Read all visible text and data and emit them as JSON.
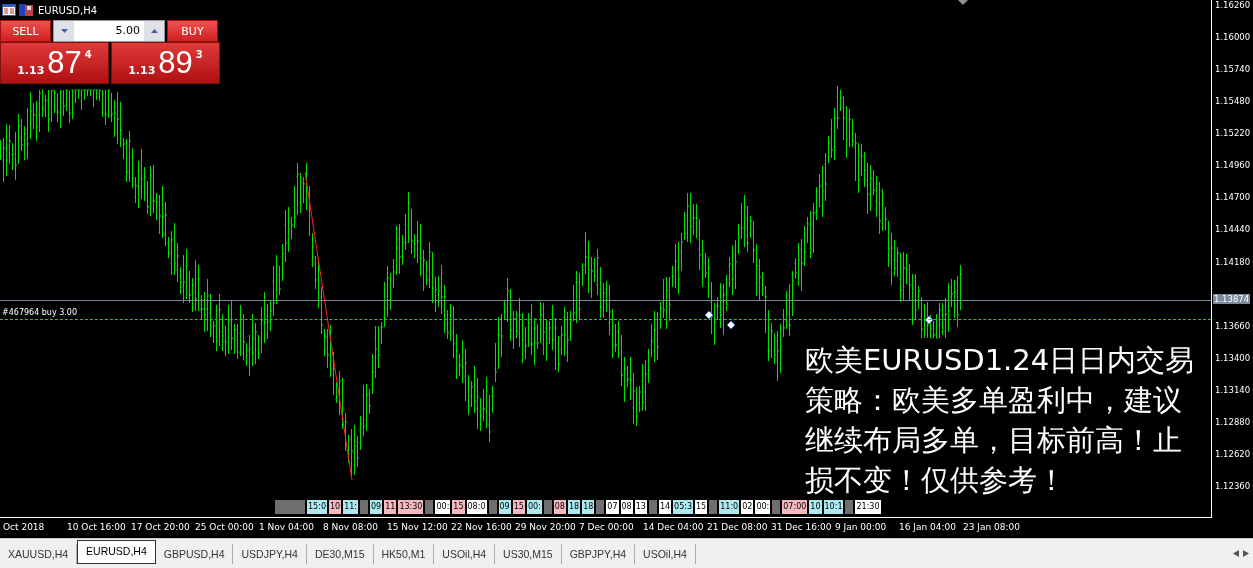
{
  "chart_window": {
    "title": "EURUSD,H4"
  },
  "trade_panel": {
    "sell_label": "SELL",
    "buy_label": "BUY",
    "lots": "5.00",
    "bid": {
      "prefix": "1.13",
      "big": "87",
      "small": "4"
    },
    "ask": {
      "prefix": "1.13",
      "big": "89",
      "small": "3"
    }
  },
  "order_line": {
    "label": "#467964 buy 3.00"
  },
  "price_axis": [
    {
      "label": "1.16260",
      "kind": "tick"
    },
    {
      "label": "1.16000",
      "kind": "tick"
    },
    {
      "label": "1.15740",
      "kind": "tick"
    },
    {
      "label": "1.15480",
      "kind": "tick"
    },
    {
      "label": "1.15220",
      "kind": "tick"
    },
    {
      "label": "1.14960",
      "kind": "tick"
    },
    {
      "label": "1.14700",
      "kind": "tick"
    },
    {
      "label": "1.14440",
      "kind": "tick"
    },
    {
      "label": "1.14180",
      "kind": "tick"
    },
    {
      "label": "1.13874",
      "kind": "current"
    },
    {
      "label": "1.13660",
      "kind": "tick"
    },
    {
      "label": "1.13400",
      "kind": "tick"
    },
    {
      "label": "1.13140",
      "kind": "tick"
    },
    {
      "label": "1.12880",
      "kind": "tick"
    },
    {
      "label": "1.12620",
      "kind": "tick"
    },
    {
      "label": "1.12360",
      "kind": "tick"
    }
  ],
  "time_axis": [
    "Oct 2018",
    "10 Oct 16:00",
    "17 Oct 20:00",
    "25 Oct 00:00",
    "1 Nov 04:00",
    "8 Nov 08:00",
    "15 Nov 12:00",
    "22 Nov 16:00",
    "29 Nov 20:00",
    "7 Dec 00:00",
    "14 Dec 04:00",
    "21 Dec 08:00",
    "31 Dec 16:00",
    "9 Jan 00:00",
    "16 Jan 04:00",
    "23 Jan 08:00"
  ],
  "events": [
    {
      "label": "15:0",
      "color": "#aee8f0"
    },
    {
      "label": "10",
      "color": "#f5b8c0"
    },
    {
      "label": "11:",
      "color": "#aee8f0"
    },
    {
      "label": "09",
      "color": "#aee8f0"
    },
    {
      "label": "11",
      "color": "#f5b8c0"
    },
    {
      "label": "13:30",
      "color": "#f5b8c0"
    },
    {
      "label": "00:",
      "color": "#ffffff"
    },
    {
      "label": "15",
      "color": "#f5b8c0"
    },
    {
      "label": "08:0",
      "color": "#ffffff"
    },
    {
      "label": "09",
      "color": "#aee8f0"
    },
    {
      "label": "15",
      "color": "#f5b8c0"
    },
    {
      "label": "00:",
      "color": "#aee8f0"
    },
    {
      "label": "08",
      "color": "#f5b8c0"
    },
    {
      "label": "18",
      "color": "#aee8f0"
    },
    {
      "label": "18",
      "color": "#aee8f0"
    },
    {
      "label": "07",
      "color": "#ffffff"
    },
    {
      "label": "08",
      "color": "#ffffff"
    },
    {
      "label": "13",
      "color": "#ffffff"
    },
    {
      "label": "14",
      "color": "#ffffff"
    },
    {
      "label": "05:3",
      "color": "#aee8f0"
    },
    {
      "label": "15",
      "color": "#ffffff"
    },
    {
      "label": "11:0",
      "color": "#aee8f0"
    },
    {
      "label": "02",
      "color": "#ffffff"
    },
    {
      "label": "00:",
      "color": "#ffffff"
    },
    {
      "label": "07:00",
      "color": "#f5b8c0"
    },
    {
      "label": "10",
      "color": "#aee8f0"
    },
    {
      "label": "10:1",
      "color": "#aee8f0"
    },
    {
      "label": "21:30",
      "color": "#ffffff"
    }
  ],
  "overlay_text": [
    "欧美EURUSD1.24日日内交易",
    "策略：欧美多单盈利中，建议",
    "继续布局多单，目标前高！止",
    "损不变！仅供参考！"
  ],
  "tabs": [
    {
      "label": "XAUUSD,H4",
      "selected": false
    },
    {
      "label": "EURUSD,H4",
      "selected": true
    },
    {
      "label": "GBPUSD,H4",
      "selected": false
    },
    {
      "label": "USDJPY,H4",
      "selected": false
    },
    {
      "label": "DE30,M15",
      "selected": false
    },
    {
      "label": "HK50,M1",
      "selected": false
    },
    {
      "label": "USOil,H4",
      "selected": false
    },
    {
      "label": "US30,M15",
      "selected": false
    },
    {
      "label": "GBPJPY,H4",
      "selected": false
    },
    {
      "label": "USOil,H4",
      "selected": false
    }
  ]
}
